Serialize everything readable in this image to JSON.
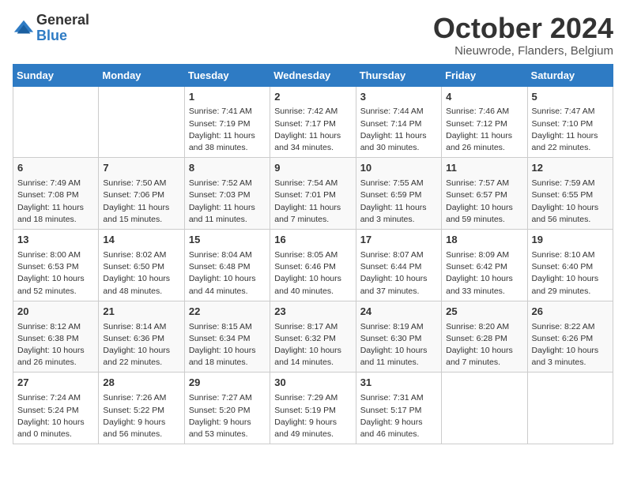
{
  "logo": {
    "general": "General",
    "blue": "Blue"
  },
  "header": {
    "month": "October 2024",
    "location": "Nieuwrode, Flanders, Belgium"
  },
  "days_of_week": [
    "Sunday",
    "Monday",
    "Tuesday",
    "Wednesday",
    "Thursday",
    "Friday",
    "Saturday"
  ],
  "weeks": [
    [
      {
        "day": "",
        "content": ""
      },
      {
        "day": "",
        "content": ""
      },
      {
        "day": "1",
        "content": "Sunrise: 7:41 AM\nSunset: 7:19 PM\nDaylight: 11 hours and 38 minutes."
      },
      {
        "day": "2",
        "content": "Sunrise: 7:42 AM\nSunset: 7:17 PM\nDaylight: 11 hours and 34 minutes."
      },
      {
        "day": "3",
        "content": "Sunrise: 7:44 AM\nSunset: 7:14 PM\nDaylight: 11 hours and 30 minutes."
      },
      {
        "day": "4",
        "content": "Sunrise: 7:46 AM\nSunset: 7:12 PM\nDaylight: 11 hours and 26 minutes."
      },
      {
        "day": "5",
        "content": "Sunrise: 7:47 AM\nSunset: 7:10 PM\nDaylight: 11 hours and 22 minutes."
      }
    ],
    [
      {
        "day": "6",
        "content": "Sunrise: 7:49 AM\nSunset: 7:08 PM\nDaylight: 11 hours and 18 minutes."
      },
      {
        "day": "7",
        "content": "Sunrise: 7:50 AM\nSunset: 7:06 PM\nDaylight: 11 hours and 15 minutes."
      },
      {
        "day": "8",
        "content": "Sunrise: 7:52 AM\nSunset: 7:03 PM\nDaylight: 11 hours and 11 minutes."
      },
      {
        "day": "9",
        "content": "Sunrise: 7:54 AM\nSunset: 7:01 PM\nDaylight: 11 hours and 7 minutes."
      },
      {
        "day": "10",
        "content": "Sunrise: 7:55 AM\nSunset: 6:59 PM\nDaylight: 11 hours and 3 minutes."
      },
      {
        "day": "11",
        "content": "Sunrise: 7:57 AM\nSunset: 6:57 PM\nDaylight: 10 hours and 59 minutes."
      },
      {
        "day": "12",
        "content": "Sunrise: 7:59 AM\nSunset: 6:55 PM\nDaylight: 10 hours and 56 minutes."
      }
    ],
    [
      {
        "day": "13",
        "content": "Sunrise: 8:00 AM\nSunset: 6:53 PM\nDaylight: 10 hours and 52 minutes."
      },
      {
        "day": "14",
        "content": "Sunrise: 8:02 AM\nSunset: 6:50 PM\nDaylight: 10 hours and 48 minutes."
      },
      {
        "day": "15",
        "content": "Sunrise: 8:04 AM\nSunset: 6:48 PM\nDaylight: 10 hours and 44 minutes."
      },
      {
        "day": "16",
        "content": "Sunrise: 8:05 AM\nSunset: 6:46 PM\nDaylight: 10 hours and 40 minutes."
      },
      {
        "day": "17",
        "content": "Sunrise: 8:07 AM\nSunset: 6:44 PM\nDaylight: 10 hours and 37 minutes."
      },
      {
        "day": "18",
        "content": "Sunrise: 8:09 AM\nSunset: 6:42 PM\nDaylight: 10 hours and 33 minutes."
      },
      {
        "day": "19",
        "content": "Sunrise: 8:10 AM\nSunset: 6:40 PM\nDaylight: 10 hours and 29 minutes."
      }
    ],
    [
      {
        "day": "20",
        "content": "Sunrise: 8:12 AM\nSunset: 6:38 PM\nDaylight: 10 hours and 26 minutes."
      },
      {
        "day": "21",
        "content": "Sunrise: 8:14 AM\nSunset: 6:36 PM\nDaylight: 10 hours and 22 minutes."
      },
      {
        "day": "22",
        "content": "Sunrise: 8:15 AM\nSunset: 6:34 PM\nDaylight: 10 hours and 18 minutes."
      },
      {
        "day": "23",
        "content": "Sunrise: 8:17 AM\nSunset: 6:32 PM\nDaylight: 10 hours and 14 minutes."
      },
      {
        "day": "24",
        "content": "Sunrise: 8:19 AM\nSunset: 6:30 PM\nDaylight: 10 hours and 11 minutes."
      },
      {
        "day": "25",
        "content": "Sunrise: 8:20 AM\nSunset: 6:28 PM\nDaylight: 10 hours and 7 minutes."
      },
      {
        "day": "26",
        "content": "Sunrise: 8:22 AM\nSunset: 6:26 PM\nDaylight: 10 hours and 3 minutes."
      }
    ],
    [
      {
        "day": "27",
        "content": "Sunrise: 7:24 AM\nSunset: 5:24 PM\nDaylight: 10 hours and 0 minutes."
      },
      {
        "day": "28",
        "content": "Sunrise: 7:26 AM\nSunset: 5:22 PM\nDaylight: 9 hours and 56 minutes."
      },
      {
        "day": "29",
        "content": "Sunrise: 7:27 AM\nSunset: 5:20 PM\nDaylight: 9 hours and 53 minutes."
      },
      {
        "day": "30",
        "content": "Sunrise: 7:29 AM\nSunset: 5:19 PM\nDaylight: 9 hours and 49 minutes."
      },
      {
        "day": "31",
        "content": "Sunrise: 7:31 AM\nSunset: 5:17 PM\nDaylight: 9 hours and 46 minutes."
      },
      {
        "day": "",
        "content": ""
      },
      {
        "day": "",
        "content": ""
      }
    ]
  ]
}
